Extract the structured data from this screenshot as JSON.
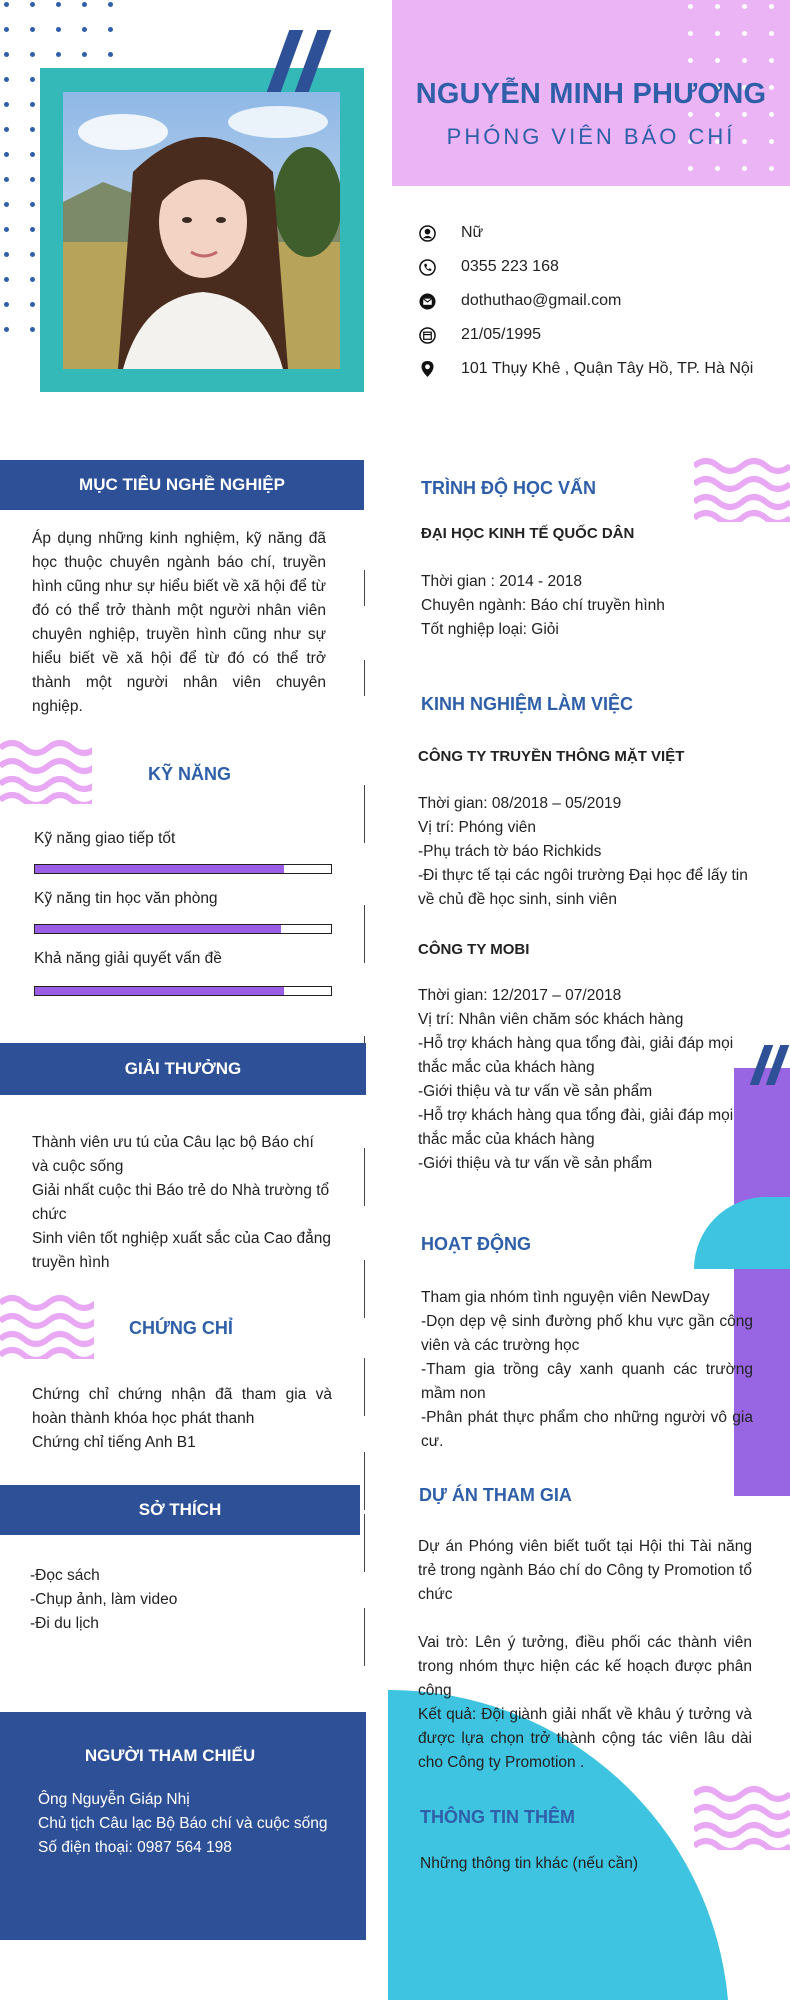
{
  "header": {
    "name": "NGUYỄN MINH PHƯƠNG",
    "job_title": "PHÓNG VIÊN BÁO CHÍ"
  },
  "contact": {
    "gender": "Nữ",
    "phone": "0355 223 168",
    "email": "dothuthao@gmail.com",
    "birthday": "21/05/1995",
    "address": "101 Thụy Khê , Quận Tây Hồ, TP. Hà Nội"
  },
  "objective": {
    "title": "MỤC TIÊU NGHỀ NGHIỆP",
    "text": "Áp dụng những kinh nghiệm, kỹ năng đã học thuộc chuyên ngành báo chí, truyền hình cũng như sự hiểu biết về xã hội để từ đó có thể trở thành một người nhân viên chuyên nghiệp, truyền hình cũng như sự hiểu biết về xã hội để từ đó có thể trở thành một người nhân viên chuyên nghiệp."
  },
  "skills": {
    "title": "KỸ NĂNG",
    "items": [
      {
        "label": "Kỹ năng giao tiếp tốt",
        "level": 0.84
      },
      {
        "label": "Kỹ năng tin học văn phòng",
        "level": 0.83
      },
      {
        "label": "Khả năng giải quyết vấn đề",
        "level": 0.84
      }
    ]
  },
  "awards": {
    "title": "GIẢI THƯỞNG",
    "items": [
      "Thành viên ưu tú của Câu lạc bộ Báo chí và cuộc sống",
      "Giải nhất cuộc thi Báo trẻ do Nhà trường tổ chức",
      "Sinh viên tốt nghiệp xuất sắc của Cao đẳng truyền hình"
    ]
  },
  "certificates": {
    "title": "CHỨNG CHỈ",
    "items": [
      "Chứng chỉ chứng nhận đã tham gia và hoàn thành khóa học phát thanh",
      "Chứng chỉ tiếng Anh B1"
    ]
  },
  "hobbies": {
    "title": "SỞ THÍCH",
    "items": [
      "-Đọc sách",
      "-Chụp ảnh, làm video",
      "-Đi du lịch"
    ]
  },
  "reference": {
    "title": "NGƯỜI THAM CHIẾU",
    "lines": [
      "Ông Nguyễn Giáp Nhị",
      "Chủ tịch Câu lạc Bộ Báo chí và cuộc sống",
      "Số điện thoại: 0987 564 198"
    ]
  },
  "education": {
    "title": "TRÌNH ĐỘ HỌC VẤN",
    "school": "ĐẠI HỌC KINH TẾ QUỐC DÂN",
    "lines": [
      "Thời gian : 2014 - 2018",
      "Chuyên ngành: Báo chí truyền hình",
      "Tốt nghiệp loại: Giỏi"
    ]
  },
  "experience": {
    "title": "KINH NGHIỆM LÀM VIỆC",
    "jobs": [
      {
        "company": "CÔNG TY TRUYỀN THÔNG MẶT VIỆT",
        "lines": [
          "Thời gian: 08/2018 – 05/2019",
          "Vị trí: Phóng viên",
          "-Phụ trách tờ báo Richkids",
          "-Đi thực tế tại các ngôi trường Đại học để lấy tin về chủ đề học sinh, sinh viên"
        ]
      },
      {
        "company": "CÔNG TY MOBI",
        "lines": [
          "Thời gian: 12/2017 – 07/2018",
          "Vị trí: Nhân viên chăm sóc khách hàng",
          "-Hỗ trợ khách hàng qua tổng đài, giải đáp mọi thắc mắc của khách hàng",
          "-Giới thiệu và tư vấn về sản phẩm",
          "-Hỗ trợ khách hàng qua tổng đài, giải đáp mọi thắc mắc của khách hàng",
          "-Giới thiệu và tư vấn về sản phẩm"
        ]
      }
    ]
  },
  "activities": {
    "title": "HOẠT ĐỘNG",
    "lines": [
      "Tham gia nhóm tình nguyện viên NewDay",
      "-Dọn dẹp vệ sinh đường phố khu vực gần công viên và các trường học",
      "-Tham gia trồng cây xanh quanh các trường mầm non",
      "-Phân phát thực phẩm cho những người vô gia cư."
    ]
  },
  "projects": {
    "title": "DỰ ÁN THAM GIA",
    "paragraphs": [
      "Dự án Phóng viên biết tuốt tại Hội thi Tài năng trẻ trong ngành Báo chí do Công ty Promotion tổ chức",
      "Vai trò: Lên ý tưởng, điều phối các thành viên trong nhóm thực hiện các kế hoạch được phân công",
      "Kết quả: Đội giành giải nhất về khâu ý tưởng và được lựa chọn trở thành cộng tác viên lâu dài cho Công ty Promotion ."
    ]
  },
  "more_info": {
    "title": "THÔNG TIN THÊM",
    "text": "Những thông tin khác (nếu cần)"
  },
  "colors": {
    "accent_blue": "#2e5fa8",
    "band_blue": "#2e5096",
    "pink": "#ebb4f5",
    "teal": "#35b8b8",
    "purple": "#9966e3",
    "cyan": "#3ec4e0"
  }
}
